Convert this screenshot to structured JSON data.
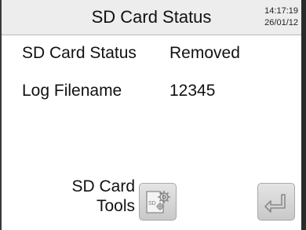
{
  "header": {
    "title": "SD Card Status",
    "time": "14:17:19",
    "date": "26/01/12"
  },
  "status": {
    "sd_label": "SD Card Status",
    "sd_value": "Removed",
    "log_label": "Log Filename",
    "log_value": "12345"
  },
  "tools": {
    "label_line1": "SD Card",
    "label_line2": "Tools",
    "icon": "sd-card-gear-icon",
    "icon_text": "SD"
  },
  "enter": {
    "icon": "enter-return-icon"
  }
}
